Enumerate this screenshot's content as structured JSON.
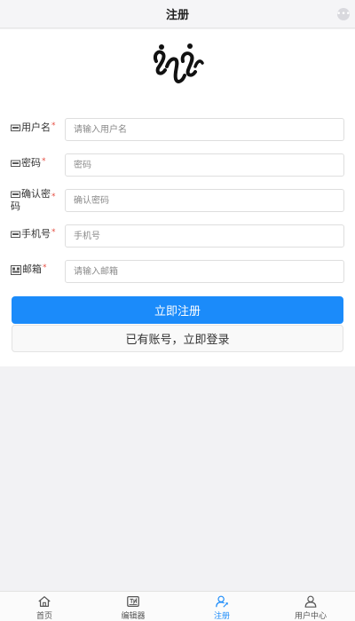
{
  "navbar": {
    "title": "注册"
  },
  "form": {
    "fields": [
      {
        "label": "用户名",
        "required": "*",
        "placeholder": "请输入用户名"
      },
      {
        "label": "密码",
        "required": "*",
        "placeholder": "密码"
      },
      {
        "label_line1": "确认密",
        "label_line2": "码",
        "required": "*",
        "placeholder": "确认密码"
      },
      {
        "label": "手机号",
        "required": "*",
        "placeholder": "手机号"
      },
      {
        "label": "邮箱",
        "required": "*",
        "placeholder": "请输入邮箱"
      }
    ],
    "register_button": "立即注册",
    "login_link": "已有账号，立即登录"
  },
  "tabbar": {
    "items": [
      {
        "label": "首页",
        "icon": "home-icon"
      },
      {
        "label": "编辑器",
        "icon": "editor-icon"
      },
      {
        "label": "注册",
        "icon": "register-icon",
        "active": true
      },
      {
        "label": "用户中心",
        "icon": "user-center-icon"
      }
    ],
    "active_color": "#1b8bfa"
  }
}
